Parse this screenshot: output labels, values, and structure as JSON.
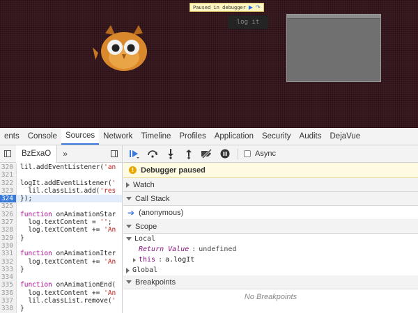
{
  "page": {
    "paused_banner": "Paused in debugger",
    "logit_button": "log it"
  },
  "devtools": {
    "tabs": [
      {
        "label": "ents"
      },
      {
        "label": "Console"
      },
      {
        "label": "Sources"
      },
      {
        "label": "Network"
      },
      {
        "label": "Timeline"
      },
      {
        "label": "Profiles"
      },
      {
        "label": "Application"
      },
      {
        "label": "Security"
      },
      {
        "label": "Audits"
      },
      {
        "label": "DejaVue"
      }
    ],
    "active_tab": "Sources",
    "file_tab": "BzExaO",
    "more_tabs": "»",
    "code_lines": [
      {
        "n": "320",
        "text": "lil.addEventListener('an"
      },
      {
        "n": "321",
        "text": ""
      },
      {
        "n": "322",
        "text": "logIt.addEventListener('"
      },
      {
        "n": "323",
        "text": "  lil.classList.add('res"
      },
      {
        "n": "324",
        "text": "});"
      },
      {
        "n": "325",
        "text": ""
      },
      {
        "n": "326",
        "text": "function onAnimationStar"
      },
      {
        "n": "327",
        "text": "  log.textContent = '';"
      },
      {
        "n": "328",
        "text": "  log.textContent += 'An"
      },
      {
        "n": "329",
        "text": "}"
      },
      {
        "n": "330",
        "text": ""
      },
      {
        "n": "331",
        "text": "function onAnimationIter"
      },
      {
        "n": "332",
        "text": "  log.textContent += 'An"
      },
      {
        "n": "333",
        "text": "}"
      },
      {
        "n": "334",
        "text": ""
      },
      {
        "n": "335",
        "text": "function onAnimationEnd("
      },
      {
        "n": "336",
        "text": "  log.textContent += 'An"
      },
      {
        "n": "337",
        "text": "  lil.classList.remove('"
      },
      {
        "n": "338",
        "text": "}"
      }
    ],
    "current_line": "324",
    "async_label": "Async",
    "paused_message": "Debugger paused",
    "sections": {
      "watch": "Watch",
      "call_stack": "Call Stack",
      "scope": "Scope",
      "breakpoints": "Breakpoints"
    },
    "call_stack_items": [
      "(anonymous)"
    ],
    "scope": {
      "local_label": "Local",
      "return_value_name": "Return Value",
      "return_value": "undefined",
      "this_name": "this",
      "this_value": "a.logIt",
      "global_label": "Global"
    },
    "no_breakpoints": "No Breakpoints"
  },
  "colors": {
    "accent": "#3879d9",
    "page_background": "#3c1c22",
    "paused_bar": "#fffbe3"
  }
}
